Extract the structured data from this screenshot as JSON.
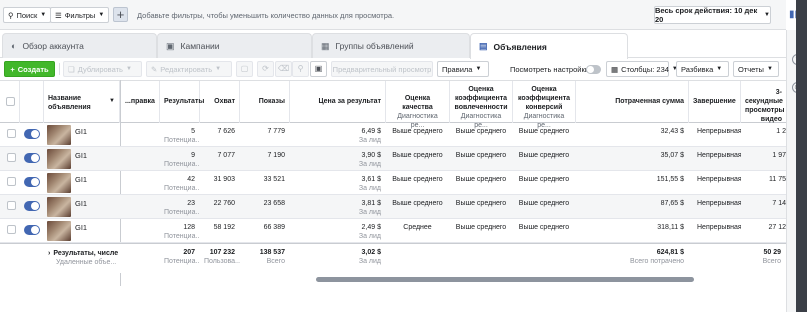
{
  "filter_bar": {
    "search_label": "Поиск",
    "filters_label": "Фильтры",
    "add_filter_hint": "Добавьте фильтры, чтобы уменьшить количество данных для просмотра.",
    "date_range_label": "Весь срок действия: 10 дек 20"
  },
  "tabs": [
    {
      "label": "Обзор аккаунта",
      "icon": "circle-info-icon"
    },
    {
      "label": "Кампании",
      "icon": "folder-icon"
    },
    {
      "label": "Группы объявлений",
      "icon": "grid-icon"
    },
    {
      "label": "Объявления",
      "icon": "ad-icon",
      "active": true
    }
  ],
  "toolbar": {
    "create_label": "Создать",
    "duplicate_label": "Дублировать",
    "edit_label": "Редактировать",
    "preview_label": "Предварительный просмотр",
    "rules_label": "Правила",
    "view_settings_label": "Посмотреть настройки",
    "columns_label": "Столбцы: 234",
    "breakdown_label": "Разбивка",
    "reports_label": "Отчеты"
  },
  "columns": {
    "name": "Название объявления",
    "delivery": "...правка",
    "results": "Результаты",
    "reach": "Охват",
    "impressions": "Показы",
    "cost_per_result": "Цена за результат",
    "quality": "Оценка качества",
    "quality_sub": "Диагностика ре...",
    "engagement": "Оценка коэффициента вовлеченности",
    "engagement_sub": "Диагностика ре...",
    "conversion": "Оценка коэффициента конверсий",
    "conversion_sub": "Диагностика ре...",
    "spent": "Потраченная сумма",
    "end": "Завершение",
    "video3s": "3-секундные просмотры видео"
  },
  "rows": [
    {
      "name": "GI1",
      "results": "5",
      "results_sub": "Потенциа...",
      "reach": "7 626",
      "impressions": "7 779",
      "cpr": "6,49 $",
      "cpr_sub": "За лид",
      "quality": "Выше среднего",
      "engagement": "Выше среднего",
      "conversion": "Выше среднего",
      "spent": "32,43 $",
      "end": "Непрерывная",
      "video": "1 2"
    },
    {
      "name": "GI1",
      "results": "9",
      "results_sub": "Потенциа...",
      "reach": "7 077",
      "impressions": "7 190",
      "cpr": "3,90 $",
      "cpr_sub": "За лид",
      "quality": "Выше среднего",
      "engagement": "Выше среднего",
      "conversion": "Выше среднего",
      "spent": "35,07 $",
      "end": "Непрерывная",
      "video": "1 97"
    },
    {
      "name": "GI1",
      "results": "42",
      "results_sub": "Потенциа...",
      "reach": "31 903",
      "impressions": "33 521",
      "cpr": "3,61 $",
      "cpr_sub": "За лид",
      "quality": "Выше среднего",
      "engagement": "Выше среднего",
      "conversion": "Выше среднего",
      "spent": "151,55 $",
      "end": "Непрерывная",
      "video": "11 75"
    },
    {
      "name": "GI1",
      "results": "23",
      "results_sub": "Потенциа...",
      "reach": "22 760",
      "impressions": "23 658",
      "cpr": "3,81 $",
      "cpr_sub": "За лид",
      "quality": "Выше среднего",
      "engagement": "Выше среднего",
      "conversion": "Выше среднего",
      "spent": "87,65 $",
      "end": "Непрерывная",
      "video": "7 14"
    },
    {
      "name": "GI1",
      "results": "128",
      "results_sub": "Потенциа...",
      "reach": "58 192",
      "impressions": "66 389",
      "cpr": "2,49 $",
      "cpr_sub": "За лид",
      "quality": "Среднее",
      "engagement": "Выше среднего",
      "conversion": "Выше среднего",
      "spent": "318,11 $",
      "end": "Непрерывная",
      "video": "27 12"
    }
  ],
  "totals": {
    "label": "Результаты, числе",
    "label_sub": "Удаленные объе...",
    "results": "207",
    "results_sub": "Потенциа...",
    "reach": "107 232",
    "reach_sub": "Пользова...",
    "impressions": "138 537",
    "impressions_sub": "Всего",
    "cpr": "3,02 $",
    "cpr_sub": "За лид",
    "spent": "624,81 $",
    "spent_sub": "Всего потрачено",
    "video": "50 29",
    "video_sub": "Всего"
  },
  "colors": {
    "accent": "#4267b2",
    "create": "#42b72a"
  }
}
